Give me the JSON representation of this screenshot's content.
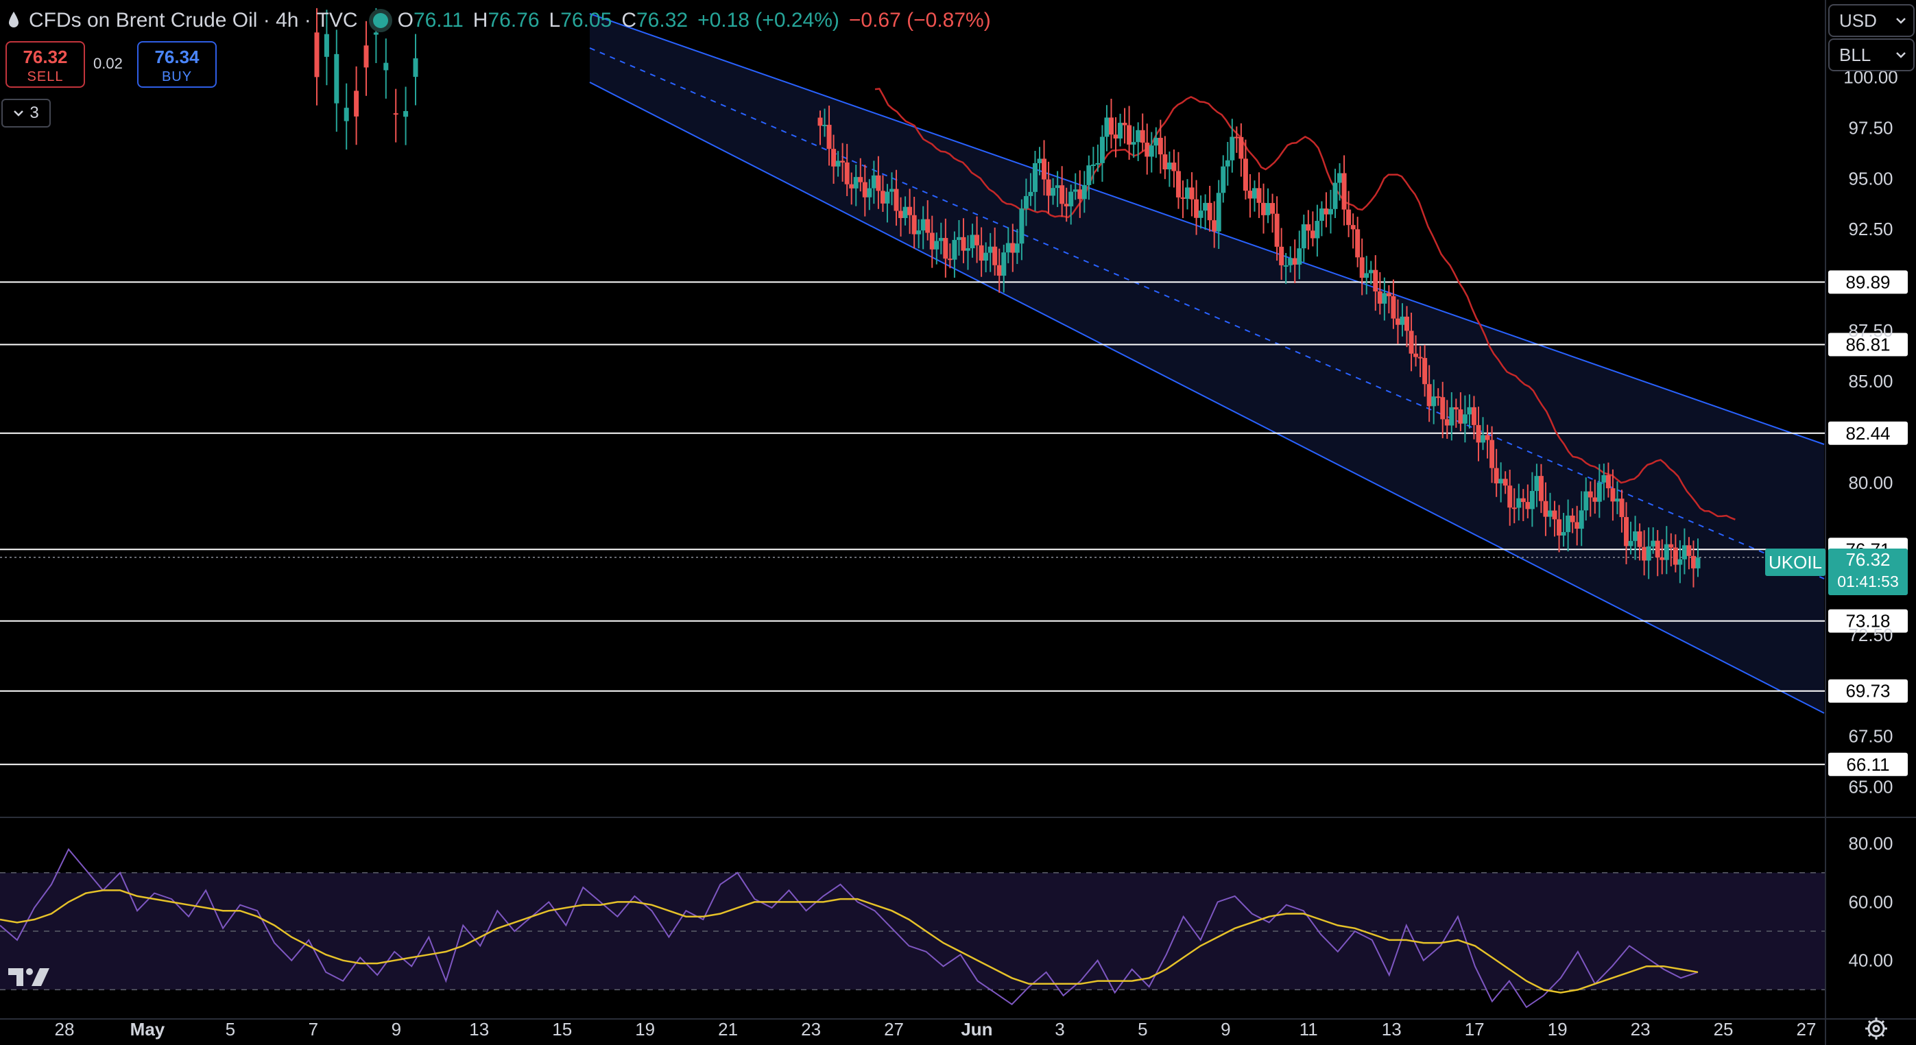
{
  "header": {
    "symbol": "CFDs on Brent Crude Oil · 4h · TVC",
    "open_label": "O",
    "open": "76.11",
    "high_label": "H",
    "high": "76.76",
    "low_label": "L",
    "low": "76.05",
    "close_label": "C",
    "close": "76.32",
    "change": "+0.18 (+0.24%)",
    "change2": "−0.67 (−0.87%)"
  },
  "trade": {
    "sell_price": "76.32",
    "sell_label": "SELL",
    "spread": "0.02",
    "buy_price": "76.34",
    "buy_label": "BUY"
  },
  "indicators_toggle": {
    "icon": "chevron-down-icon",
    "count": "3"
  },
  "currency_select": {
    "value": "USD"
  },
  "unit_select": {
    "value": "BLL"
  },
  "last_price": {
    "symbol": "UKOIL",
    "price": "76.32",
    "countdown": "01:41:53"
  },
  "colors": {
    "up": "#26a69a",
    "down": "#ef5350",
    "ma": "#c62828",
    "channel": "#2962ff",
    "rsi": "#7e57c2",
    "rsi_ma": "#e6c229",
    "hline": "#ffffff"
  },
  "chart_data": [
    {
      "type": "candlestick",
      "title": "CFDs on Brent Crude Oil · 4h · TVC",
      "x_tick_labels": [
        "28",
        "May",
        "5",
        "7",
        "9",
        "13",
        "15",
        "19",
        "21",
        "23",
        "27",
        "Jun",
        "3",
        "5",
        "9",
        "11",
        "13",
        "17",
        "19",
        "23",
        "25",
        "27"
      ],
      "ylim": [
        63.5,
        103.8
      ],
      "y_tick_labels": [
        "100.00",
        "97.50",
        "95.00",
        "92.50",
        "87.50",
        "85.00",
        "80.00",
        "72.50",
        "67.50",
        "65.00"
      ],
      "horizontal_levels": [
        "89.89",
        "86.81",
        "82.44",
        "76.71",
        "73.18",
        "69.73",
        "66.11"
      ],
      "moving_average": true,
      "regression_channel": true,
      "series": [
        {
          "x": [
            0,
            4,
            8,
            12,
            16,
            20,
            24,
            28,
            32,
            36,
            40,
            44,
            48,
            52,
            56,
            60,
            64,
            68,
            72,
            76,
            80,
            84,
            88,
            92,
            96,
            100,
            104,
            108,
            112,
            116,
            120,
            124,
            128,
            132,
            136,
            140,
            144,
            148,
            152,
            156,
            160,
            164,
            168,
            172,
            176,
            180,
            184,
            188,
            192,
            196,
            200,
            204,
            208,
            212,
            216,
            220,
            224,
            228,
            232,
            236
          ],
          "values": [
            97.6,
            95.6,
            94.6,
            94.6,
            94.0,
            92.9,
            92.3,
            91.3,
            91.9,
            91.5,
            90.7,
            92.1,
            95.8,
            94.3,
            93.9,
            95.1,
            97.5,
            97.3,
            96.7,
            96.4,
            94.5,
            93.6,
            92.9,
            97.4,
            94.1,
            93.6,
            90.3,
            92.2,
            93.0,
            94.9,
            91.0,
            89.6,
            88.5,
            86.9,
            84.3,
            83.2,
            83.5,
            82.2,
            79.8,
            78.7,
            79.8,
            77.8,
            77.9,
            79.4,
            80.1,
            77.4,
            76.7,
            76.6,
            76.4,
            76.3,
            0,
            0,
            0,
            0,
            0,
            0,
            0,
            0,
            0,
            0
          ],
          "name": ""
        }
      ]
    },
    {
      "type": "line",
      "ylim": [
        20,
        88
      ],
      "y_tick_labels": [
        "80.00",
        "60.00",
        "40.00"
      ],
      "bands": [
        70,
        50,
        30
      ],
      "series": [
        {
          "name": "",
          "values": [
            52,
            47,
            58,
            66,
            78,
            71,
            64,
            70,
            57,
            63,
            61,
            55,
            64,
            51,
            59,
            57,
            46,
            40,
            47,
            36,
            33,
            41,
            35,
            43,
            38,
            48,
            33,
            52,
            45,
            57,
            50,
            55,
            60,
            52,
            65,
            60,
            55,
            62,
            57,
            48,
            57,
            54,
            66,
            70,
            61,
            58,
            64,
            57,
            62,
            66,
            60,
            57,
            51,
            45,
            43,
            38,
            42,
            33,
            29,
            25,
            31,
            36,
            28,
            33,
            40,
            29,
            37,
            31,
            42,
            55,
            47,
            60,
            62,
            56,
            53,
            59,
            57,
            49,
            43,
            50,
            47,
            35,
            52,
            40,
            45,
            55,
            38,
            26,
            33,
            24,
            28,
            34,
            43,
            32,
            38,
            45,
            41,
            37,
            34,
            36
          ]
        },
        {
          "name": "",
          "values": [
            54,
            53,
            54,
            56,
            60,
            63,
            64,
            64,
            62,
            61,
            60,
            59,
            58,
            57,
            57,
            55,
            52,
            48,
            45,
            42,
            40,
            39,
            39,
            40,
            41,
            42,
            43,
            45,
            48,
            51,
            53,
            55,
            57,
            58,
            59,
            59,
            60,
            60,
            59,
            57,
            55,
            55,
            56,
            58,
            60,
            60,
            60,
            60,
            60,
            61,
            61,
            59,
            57,
            54,
            50,
            46,
            43,
            40,
            37,
            34,
            32,
            32,
            32,
            32,
            33,
            33,
            33,
            34,
            37,
            41,
            45,
            48,
            51,
            53,
            55,
            56,
            56,
            54,
            52,
            51,
            49,
            47,
            47,
            46,
            46,
            47,
            45,
            41,
            37,
            33,
            30,
            29,
            30,
            32,
            34,
            36,
            38,
            38,
            37,
            36
          ]
        }
      ]
    }
  ]
}
